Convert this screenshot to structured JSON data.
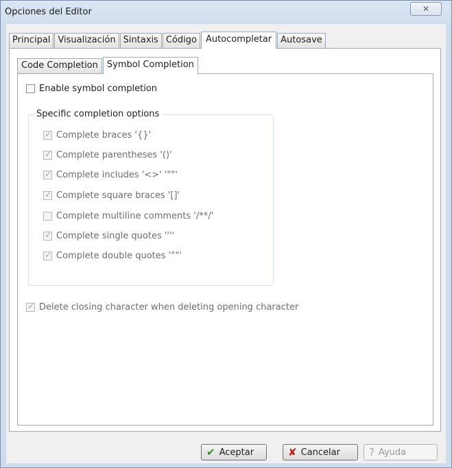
{
  "window": {
    "title": "Opciones del Editor",
    "close_glyph": "✕"
  },
  "tabs": [
    "Principal",
    "Visualización",
    "Sintaxis",
    "Código",
    "Autocompletar",
    "Autosave"
  ],
  "active_tab": "Autocompletar",
  "subtabs": [
    "Code Completion",
    "Symbol Completion"
  ],
  "active_subtab": "Symbol Completion",
  "enable_symbol_completion": {
    "label": "Enable symbol completion",
    "checked": false
  },
  "group": {
    "title": "Specific completion options",
    "options": [
      {
        "label": "Complete braces '{}'",
        "checked": true
      },
      {
        "label": "Complete parentheses '()'",
        "checked": true
      },
      {
        "label": "Complete includes '<>' '\"\"'",
        "checked": true
      },
      {
        "label": "Complete square braces '[]'",
        "checked": true
      },
      {
        "label": "Complete multiline comments '/**/'",
        "checked": false
      },
      {
        "label": "Complete single quotes ''''",
        "checked": true
      },
      {
        "label": "Complete double quotes '\"\"'",
        "checked": true
      }
    ]
  },
  "delete_closing": {
    "label": "Delete closing character when deleting opening character",
    "checked": true
  },
  "buttons": {
    "ok": "Aceptar",
    "cancel": "Cancelar",
    "help": "Ayuda"
  },
  "colors": {
    "ok_icon": "#2d8a1d",
    "cancel_icon": "#c21a1a"
  }
}
